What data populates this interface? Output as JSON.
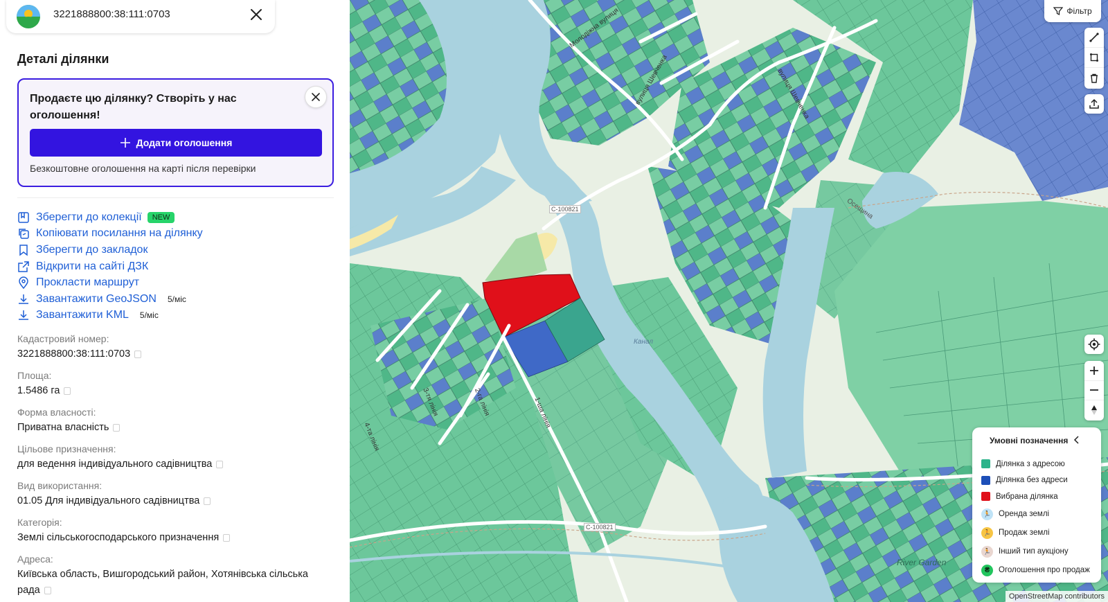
{
  "header": {
    "search_value": "3221888800:38:111:0703"
  },
  "panel": {
    "title": "Деталі ділянки",
    "promo": {
      "title": "Продаєте цю ділянку? Створіть у нас оголошення!",
      "button_label": "Додати оголошення",
      "note": "Безкоштовне оголошення на карті після перевірки"
    },
    "actions": [
      {
        "label": "Зберегти до колекції",
        "icon": "collection-icon",
        "badge": "NEW"
      },
      {
        "label": "Копіювати посилання на ділянку",
        "icon": "copy-link-icon"
      },
      {
        "label": "Зберегти до закладок",
        "icon": "bookmark-icon"
      },
      {
        "label": "Відкрити на сайті ДЗК",
        "icon": "external-link-icon"
      },
      {
        "label": "Прокласти маршрут",
        "icon": "location-pin-icon"
      },
      {
        "label": "Завантажити GeoJSON",
        "icon": "download-icon",
        "rate": "5/міс"
      },
      {
        "label": "Завантажити KML",
        "icon": "download-icon",
        "rate": "5/міс"
      }
    ],
    "details": [
      {
        "label": "Кадастровий номер:",
        "value": "3221888800:38:111:0703"
      },
      {
        "label": "Площа:",
        "value": "1.5486 га"
      },
      {
        "label": "Форма власності:",
        "value": "Приватна власність"
      },
      {
        "label": "Цільове призначення:",
        "value": "для ведення індивідуального садівництва"
      },
      {
        "label": "Вид використання:",
        "value": "01.05 Для індивідуального садівництва"
      },
      {
        "label": "Категорія:",
        "value": "Землі сільськогосподарського призначення"
      },
      {
        "label": "Адреса:",
        "value": "Київська область, Вишгородський район, Хотянівська сільська рада"
      }
    ]
  },
  "map": {
    "filter_label": "Фільтр",
    "labels": {
      "canal": "Канал",
      "river_garden": "River Garden",
      "road_1": "С-100821",
      "road_2": "С-100821",
      "street_1": "вулиця Шевченка",
      "street_2": "вулиця Шевченка",
      "street_3": "Осещина",
      "street_4": "1-ша лінія",
      "street_5": "2-га лінія",
      "street_6": "3-тя лінія",
      "street_7": "4-та лінія",
      "street_8": "Молодіжна вулиця"
    },
    "legend": {
      "title": "Умовні позначення",
      "items": [
        {
          "label": "Ділянка з адресою",
          "color": "#2bb38a"
        },
        {
          "label": "Ділянка без адреси",
          "color": "#1d4fb8"
        },
        {
          "label": "Вибрана ділянка",
          "color": "#e0101a"
        },
        {
          "label": "Оренда землі",
          "color": "#bfe3f7"
        },
        {
          "label": "Продаж землі",
          "color": "#f7c544"
        },
        {
          "label": "Інший тип аукціону",
          "color": "#e9d6d0"
        },
        {
          "label": "Оголошення про продаж",
          "color": "#22c55e"
        }
      ]
    },
    "attribution": "OpenStreetMap contributors"
  },
  "colors": {
    "accent": "#3314e0",
    "link": "#1f5fd6",
    "water": "#a9d2df",
    "parcel_green": "#6cc79b",
    "parcel_blue": "#4a6fc2",
    "selected": "#e0101a"
  }
}
